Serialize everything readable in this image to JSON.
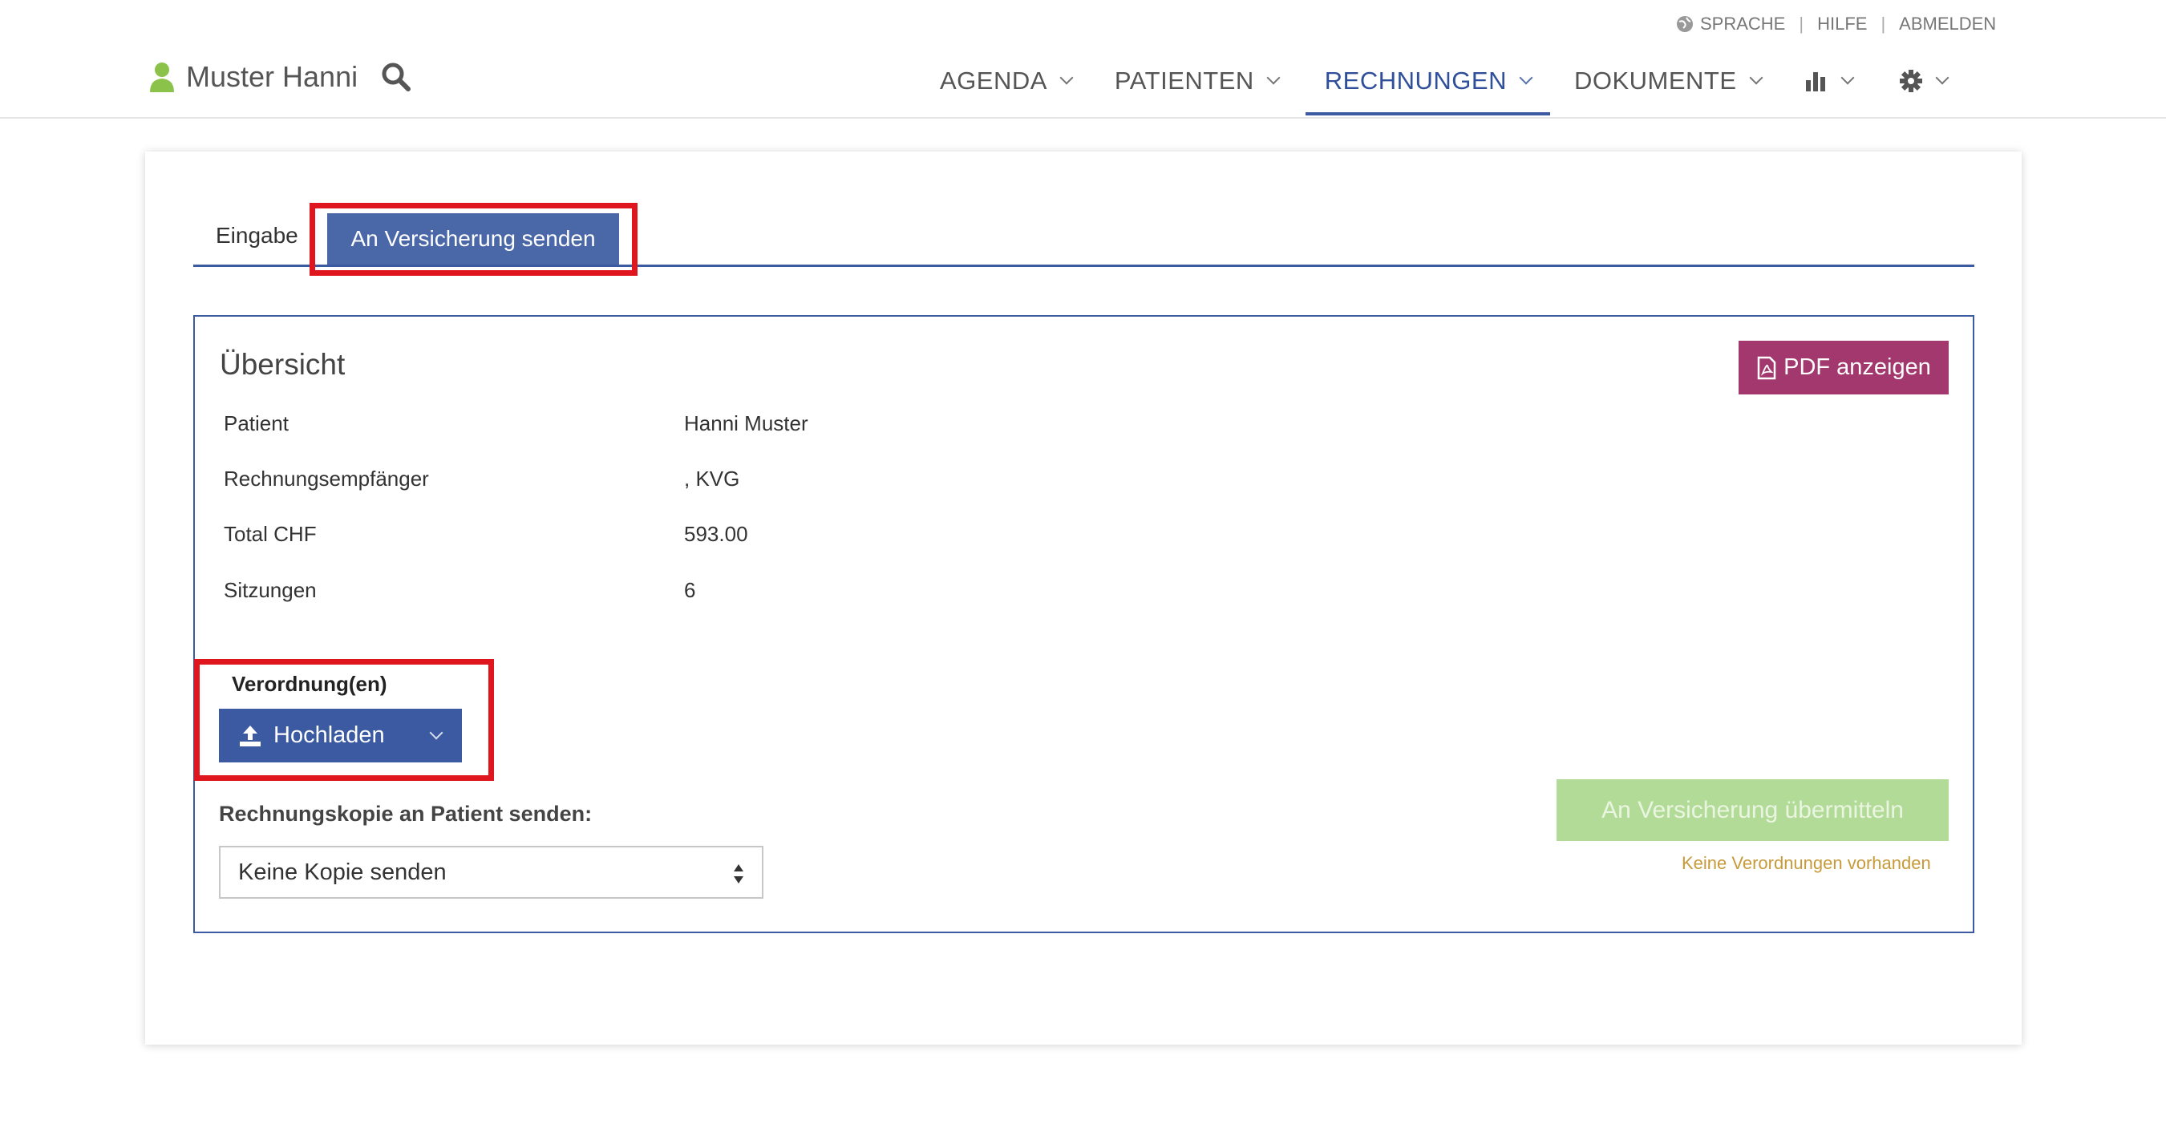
{
  "top_links": {
    "language": "SPRACHE",
    "help": "HILFE",
    "logout": "ABMELDEN",
    "separator": "|"
  },
  "user": {
    "name": "Muster Hanni"
  },
  "nav": {
    "items": [
      {
        "label": "AGENDA"
      },
      {
        "label": "PATIENTEN"
      },
      {
        "label": "RECHNUNGEN"
      },
      {
        "label": "DOKUMENTE"
      }
    ],
    "active": "RECHNUNGEN"
  },
  "tabs": {
    "input": "Eingabe",
    "send": "An Versicherung senden"
  },
  "overview": {
    "title": "Übersicht",
    "pdf_button": "PDF anzeigen",
    "rows": [
      {
        "label": "Patient",
        "value": "Hanni Muster"
      },
      {
        "label": "Rechnungsempfänger",
        "value": ", KVG"
      },
      {
        "label": "Total CHF",
        "value": "593.00"
      },
      {
        "label": "Sitzungen",
        "value": "6"
      }
    ]
  },
  "prescriptions": {
    "label": "Verordnung(en)",
    "upload_button": "Hochladen"
  },
  "copy": {
    "label": "Rechnungskopie an Patient senden:",
    "selected": "Keine Kopie senden"
  },
  "submit": {
    "label": "An Versicherung übermitteln",
    "warning": "Keine Verordnungen vorhanden"
  },
  "colors": {
    "primary": "#3b5aa2",
    "pdf": "#a2386e",
    "submit_disabled": "#b3db98",
    "highlight": "#e0161f",
    "user_icon": "#8bc34a",
    "warning": "#c79a3a"
  }
}
